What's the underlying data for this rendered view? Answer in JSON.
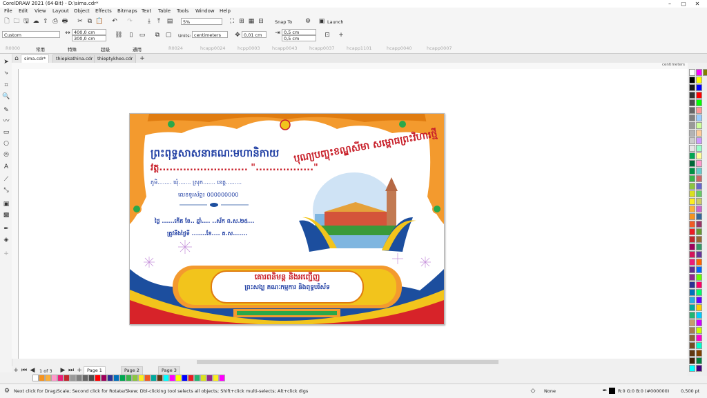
{
  "window": {
    "title": "CorelDRAW 2021 (64-Bit) - D:\\sima.cdr*"
  },
  "menu": [
    "File",
    "Edit",
    "View",
    "Layout",
    "Object",
    "Effects",
    "Bitmaps",
    "Text",
    "Table",
    "Tools",
    "Window",
    "Help"
  ],
  "toolbar1": {
    "zoom": "5%",
    "snap_to": "Snap To",
    "launch": "Launch"
  },
  "toolbar2": {
    "page_preset": "Custom",
    "width": "400,0 cm",
    "height": "300,0 cm",
    "units_label": "Units:",
    "units_value": "centimeters",
    "nudge": "0,01 cm",
    "dup_x": "0,5 cm",
    "dup_y": "0,5 cm"
  },
  "toolbar3": {
    "items": [
      "R0000",
      "常用",
      "特殊",
      "超級",
      "通用",
      "R0024",
      "hcapp0024",
      "hcpp0003",
      "hcapp0043",
      "hcapp0037",
      "hcapp1101",
      "hcapp0040",
      "hcapp0007"
    ]
  },
  "doc_tabs": [
    "sima.cdr*",
    "thiepkathina.cdr",
    "thieptykheo.cdr"
  ],
  "ruler": {
    "units_label": "centimeters"
  },
  "pages": {
    "counter": "1 of 3",
    "tabs": [
      "Page 1",
      "Page 2",
      "Page 3"
    ]
  },
  "status": {
    "hint": "Next click for Drag/Scale; Second click for Rotate/Skew; Dbl-clicking tool selects all objects; Shift+click multi-selects; Alt+click digs",
    "fill": "None",
    "outline_color": "R:0 G:0 B:0 (#000000)",
    "outline_width": "0,500 pt"
  },
  "card": {
    "title1": "ព្រះពុទ្ធសាសនាគណៈមហានិកាយ",
    "title2": "វត្ត.......................... \".................\"",
    "line3": "ភូមិ........ ឃុំ....... ស្រុក....... ខេត្ត.........",
    "phone": "លេខទូរស័ព្ទ៖ 000000000",
    "date_line": "ថ្ងៃ ......កើត ខែ.. ឆ្នាំ.... ..ស័ក ព.ស.២៥...",
    "date_line2": "ត្រូវនឹងថ្ងៃទី .......ខែ.... គ.ស.......",
    "headline": "បុណ្យបញ្ចុះខណ្ឌសីមា សម្ពោធព្រះវិហារថ្មី",
    "footer1": "គោរពនិមន្ត និងអញ្ជើញ",
    "footer2": "ព្រះសង្ឃ គណៈកម្មការ និងពុទ្ធបរិស័ទ"
  },
  "colors": {
    "accent_orange": "#f39a2e",
    "card_blue": "#1c4e9e",
    "title_blue": "#2442a5",
    "title_red": "#c8202a",
    "flag_yellow": "#f2c41c",
    "flag_red": "#d72329"
  },
  "palette_right": [
    "#ffffff",
    "#000000",
    "#1a1a1a",
    "#333333",
    "#4d4d4d",
    "#666666",
    "#808080",
    "#999999",
    "#b3b3b3",
    "#cccccc",
    "#e6e6e6",
    "#00a651",
    "#006837",
    "#009245",
    "#39b54a",
    "#8cc63f",
    "#d9e021",
    "#fcee21",
    "#fbb03b",
    "#f7931e",
    "#f15a24",
    "#ed1c24",
    "#c1272d",
    "#9e005d",
    "#d4145a",
    "#ed1e79",
    "#662d91",
    "#93278f",
    "#2e3192",
    "#0071bc",
    "#29abe2",
    "#00a99d",
    "#22b573",
    "#c69c6d",
    "#a67c52",
    "#8c6239",
    "#754c24",
    "#603813",
    "#42210b",
    "#00ffff",
    "#ff00ff",
    "#ffff00",
    "#0000ff",
    "#ff0000",
    "#00ff00",
    "#ff9999",
    "#99ccff",
    "#ccff99",
    "#ffcc99",
    "#cc99ff",
    "#99ffcc",
    "#ffff99",
    "#ff99cc",
    "#66cccc",
    "#cc6666",
    "#6666cc",
    "#66cc66",
    "#cccc66",
    "#cc66cc",
    "#336699",
    "#993366",
    "#669933",
    "#996633",
    "#339966",
    "#663399",
    "#ff6600",
    "#0066ff",
    "#66ff00",
    "#ff0066",
    "#00ff66",
    "#6600ff",
    "#ffcc00",
    "#00ccff",
    "#cc00ff",
    "#ccff00",
    "#ff00cc",
    "#00ffcc",
    "#804000",
    "#008040",
    "#400080",
    "#808000"
  ],
  "palette_bottom": [
    "#ffffff",
    "#f7931e",
    "#fbb03b",
    "#ff99cc",
    "#ed1e79",
    "#c1272d",
    "#999999",
    "#808080",
    "#666666",
    "#4d4d4d",
    "#ff0000",
    "#9e005d",
    "#2e3192",
    "#0071bc",
    "#00a651",
    "#39b54a",
    "#8cc63f",
    "#fcee21",
    "#f15a24",
    "#00a99d",
    "#603813",
    "#00ffff",
    "#ff00ff",
    "#ffff00",
    "#0000ff",
    "#ed1c24",
    "#22b573",
    "#d9e021",
    "#93278f",
    "#fcee21",
    "#ff00ff"
  ]
}
